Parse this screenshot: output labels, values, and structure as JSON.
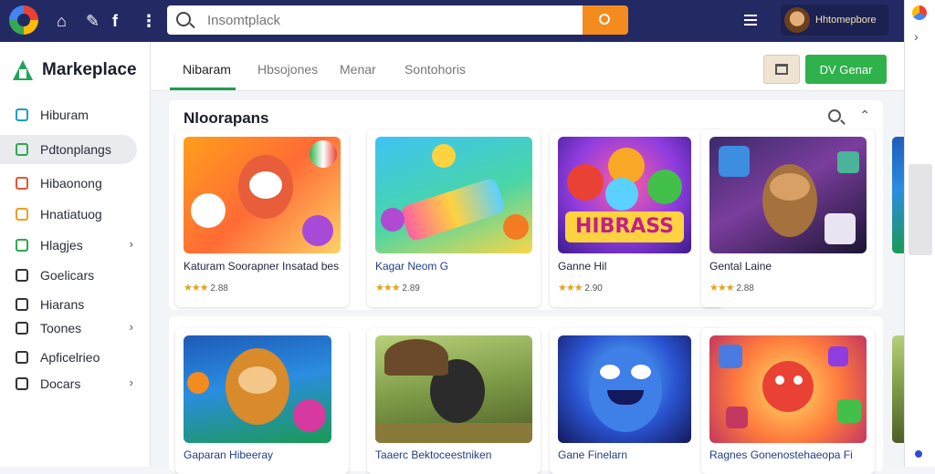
{
  "topbar": {
    "search": {
      "placeholder": "Insomtplack"
    },
    "user_name": "Hhtomepbore"
  },
  "sidebar": {
    "brand": "Markeplace",
    "items": [
      {
        "label": "Hiburam",
        "color": "#1a9fc4",
        "chevron": false
      },
      {
        "label": "Pdtonplangs",
        "color": "#2fa84f",
        "chevron": false,
        "active": true
      },
      {
        "label": "Hibaonong",
        "color": "#e2553c",
        "chevron": false
      },
      {
        "label": "Hnatiatuog",
        "color": "#f0a020",
        "chevron": false
      },
      {
        "label": "Hlagjes",
        "color": "#2fa84f",
        "chevron": true
      },
      {
        "label": "Goelicars",
        "color": "#333333",
        "chevron": false
      },
      {
        "label": "Hiarans",
        "color": "#333333",
        "chevron": false
      },
      {
        "label": "Toones",
        "color": "#333333",
        "chevron": true
      },
      {
        "label": "Apficelrieo",
        "color": "#333333",
        "chevron": false
      },
      {
        "label": "Docars",
        "color": "#333333",
        "chevron": true
      }
    ]
  },
  "tabs": [
    {
      "label": "Nibaram",
      "active": true
    },
    {
      "label": "Hbsojones",
      "active": false
    },
    {
      "label": "Menar",
      "active": false
    },
    {
      "label": "Sontohoris",
      "active": false
    }
  ],
  "actions": {
    "primary_label": "DV Genar"
  },
  "panel": {
    "title": "Nloorapans",
    "row1": [
      {
        "title": "Katuram Soorapner Insatad bes",
        "rating": "2.88"
      },
      {
        "title": "Kagar Neom G",
        "rating": "2.89"
      },
      {
        "title": "Ganne Hil",
        "rating": "2.90"
      },
      {
        "title": "Gental Laine",
        "rating": "2.88"
      }
    ],
    "row2": [
      {
        "title": "Gaparan Hibeeray"
      },
      {
        "title": "Taaerc Bektoceestniken"
      },
      {
        "title": "Gane Finelarn"
      },
      {
        "title": "Ragnes Gonenostehaeopa Fi"
      }
    ],
    "hibrass_text": "HIBRASS"
  }
}
